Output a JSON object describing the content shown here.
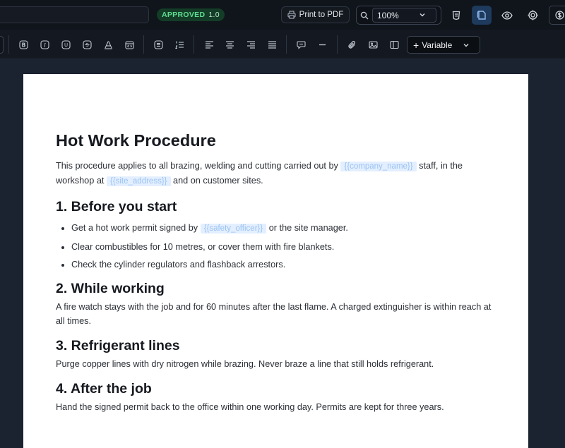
{
  "header": {
    "status": "APPROVED",
    "version": "1.0",
    "print_label": "Print to PDF",
    "zoom": "100%",
    "icons": [
      "html-icon",
      "document-icon",
      "eye-icon",
      "target-icon",
      "dollar-icon"
    ]
  },
  "toolbar": {
    "variable_label": "Variable"
  },
  "document": {
    "title": "Hot Work Procedure",
    "intro": {
      "t1": "This procedure applies to all brazing, welding and cutting carried out by ",
      "v1": "{{company_name}}",
      "t2": " staff, in the workshop at ",
      "v2": "{{site_address}}",
      "t3": " and on customer sites."
    },
    "s1": {
      "heading": "1. Before you start",
      "b1_a": "Get a hot work permit signed by ",
      "b1_var": "{{safety_officer}}",
      "b1_b": " or the site manager.",
      "b2": "Clear combustibles for 10 metres, or cover them with fire blankets.",
      "b3": "Check the cylinder regulators and flashback arrestors."
    },
    "s2": {
      "heading": "2. While working",
      "text": "A fire watch stays with the job and for 60 minutes after the last flame. A charged extinguisher is within reach at all times."
    },
    "s3": {
      "heading": "3. Refrigerant lines",
      "text": "Purge copper lines with dry nitrogen while brazing. Never braze a line that still holds refrigerant."
    },
    "s4": {
      "heading": "4. After the job",
      "text": "Hand the signed permit back to the office within one working day. Permits are kept for three years."
    }
  },
  "colors": {
    "accent": "#1e3a5c",
    "approved": "#5fdc8f",
    "variable_bg": "#e3efff"
  }
}
